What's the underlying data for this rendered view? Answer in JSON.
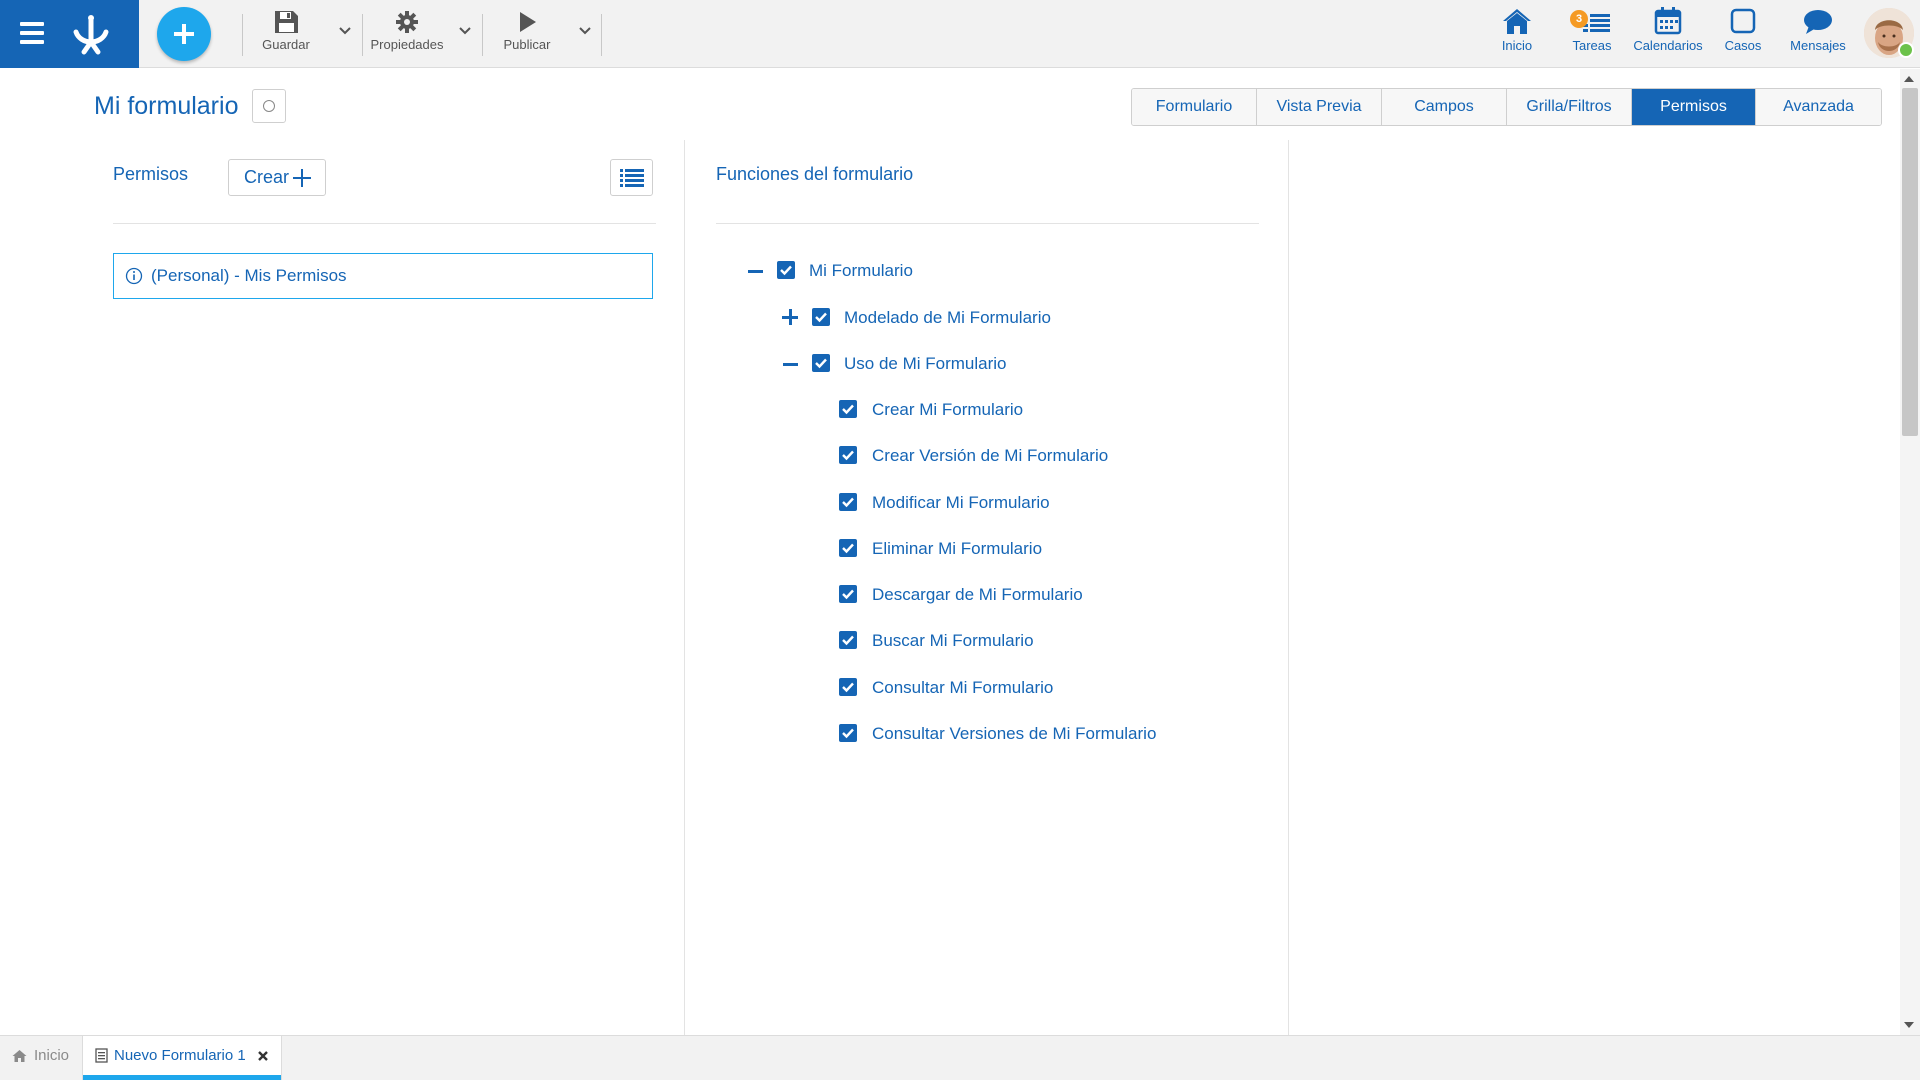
{
  "toolbar": {
    "save_label": "Guardar",
    "properties_label": "Propiedades",
    "publish_label": "Publicar"
  },
  "topnav": {
    "home_label": "Inicio",
    "tasks_label": "Tareas",
    "tasks_badge": "3",
    "calendars_label": "Calendarios",
    "cases_label": "Casos",
    "messages_label": "Mensajes"
  },
  "header": {
    "title": "Mi formulario",
    "tabs": [
      {
        "label": "Formulario",
        "active": false
      },
      {
        "label": "Vista Previa",
        "active": false
      },
      {
        "label": "Campos",
        "active": false
      },
      {
        "label": "Grilla/Filtros",
        "active": false
      },
      {
        "label": "Permisos",
        "active": true
      },
      {
        "label": "Avanzada",
        "active": false
      }
    ]
  },
  "permissions_panel": {
    "title": "Permisos",
    "create_label": "Crear",
    "items": [
      {
        "label": "(Personal) - Mis Permisos"
      }
    ]
  },
  "functions_panel": {
    "title": "Funciones del formulario",
    "tree": [
      {
        "label": "Mi Formulario",
        "checked": true,
        "toggle": "minus"
      },
      {
        "label": "Modelado de Mi Formulario",
        "checked": true,
        "toggle": "plus"
      },
      {
        "label": "Uso de Mi Formulario",
        "checked": true,
        "toggle": "minus"
      },
      {
        "label": "Crear Mi Formulario",
        "checked": true
      },
      {
        "label": "Crear Versión de Mi Formulario",
        "checked": true
      },
      {
        "label": "Modificar Mi Formulario",
        "checked": true
      },
      {
        "label": "Eliminar Mi Formulario",
        "checked": true
      },
      {
        "label": "Descargar de Mi Formulario",
        "checked": true
      },
      {
        "label": "Buscar Mi Formulario",
        "checked": true
      },
      {
        "label": "Consultar Mi Formulario",
        "checked": true
      },
      {
        "label": "Consultar Versiones de Mi Formulario",
        "checked": true
      }
    ]
  },
  "bottom_tabs": {
    "home_label": "Inicio",
    "open_tab_label": "Nuevo Formulario 1"
  },
  "colors": {
    "brand": "#1565b5",
    "accent": "#1ea7ec",
    "badge": "#f59a23",
    "online": "#6cc24a"
  },
  "icons": {
    "menu": "hamburger-icon",
    "logo": "app-logo-icon",
    "new": "plus-icon",
    "save": "floppy-disk-icon",
    "properties": "gear-icon",
    "publish": "play-icon",
    "home": "house-icon",
    "tasks": "task-list-icon",
    "calendars": "calendar-icon",
    "cases": "square-icon",
    "messages": "chat-bubble-icon",
    "list_view": "list-icon",
    "info": "info-icon",
    "close": "close-icon"
  }
}
